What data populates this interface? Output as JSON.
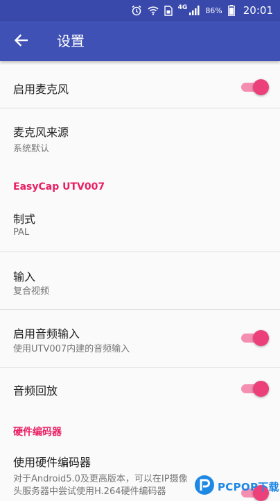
{
  "status_bar": {
    "network": "4G",
    "battery": "86%",
    "time": "20:01"
  },
  "app_bar": {
    "title": "设置"
  },
  "settings": {
    "enable_mic": {
      "title": "启用麦克风",
      "enabled": true
    },
    "mic_source": {
      "title": "麦克风来源",
      "subtitle": "系统默认"
    },
    "section_easycap": "EasyCap UTV007",
    "format": {
      "title": "制式",
      "subtitle": "PAL"
    },
    "input": {
      "title": "输入",
      "subtitle": "复合视频"
    },
    "enable_audio_input": {
      "title": "启用音频输入",
      "subtitle": "使用UTV007内建的音频输入",
      "enabled": true
    },
    "audio_playback": {
      "title": "音频回放",
      "enabled": true
    },
    "section_encoder": "硬件编码器",
    "hw_encoder": {
      "title": "使用硬件编码器",
      "subtitle_line1": "对于Android5.0及更高版本，可以在IP摄像",
      "subtitle_line2": "头服务器中尝试使用H.264硬件编码器",
      "enabled": true
    }
  },
  "watermark": {
    "text": "PCPOP下载"
  },
  "colors": {
    "primary": "#3f51b5",
    "status_bar": "#3949ab",
    "accent": "#e91e63"
  }
}
